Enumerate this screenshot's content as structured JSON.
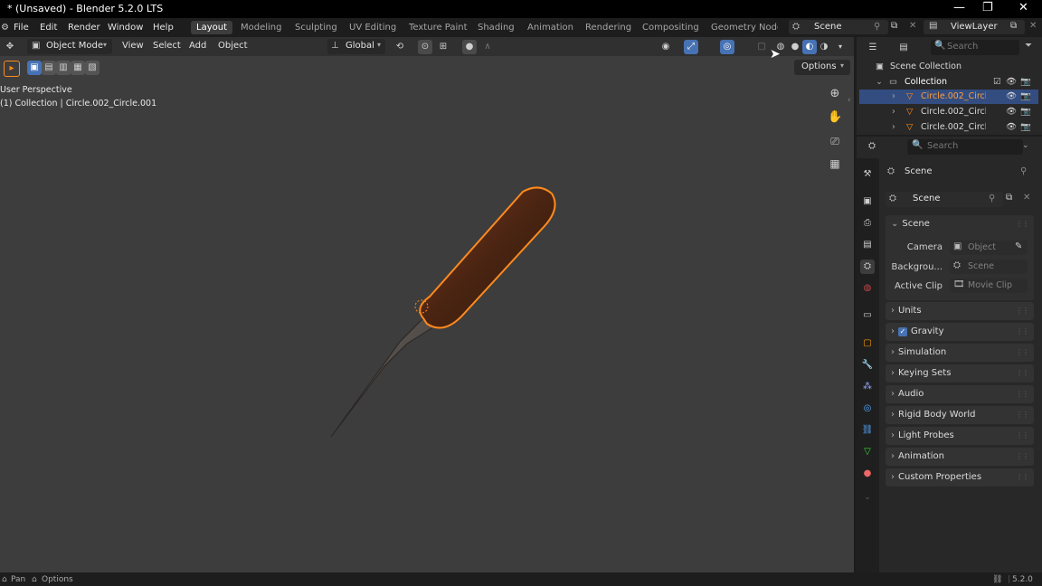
{
  "window": {
    "title": "* (Unsaved) - Blender 5.2.0 LTS",
    "controls": [
      "—",
      "❐",
      "✕"
    ]
  },
  "menu": [
    "File",
    "Edit",
    "Render",
    "Window",
    "Help"
  ],
  "workspaces": [
    "Layout",
    "Modeling",
    "Sculpting",
    "UV Editing",
    "Texture Paint",
    "Shading",
    "Animation",
    "Rendering",
    "Compositing",
    "Geometry Node"
  ],
  "scene_selector": "Scene",
  "view_layer": "ViewLayer",
  "viewport_header": {
    "mode": "Object Mode",
    "menus": [
      "View",
      "Select",
      "Add",
      "Object"
    ],
    "orientation": "Global",
    "options": "Options"
  },
  "viewport_overlay": {
    "perspective": "User Perspective",
    "context": "(1) Collection | Circle.002_Circle.001"
  },
  "outliner": {
    "search_placeholder": "Search",
    "scene_collection": "Scene Collection",
    "collection": "Collection",
    "items": [
      "Circle.002_Circl",
      "Circle.002_Circl",
      "Circle.002_Circl"
    ]
  },
  "properties": {
    "search_placeholder": "Search",
    "context_title": "Scene",
    "scene_name": "Scene",
    "scene_section": "Scene",
    "camera_label": "Camera",
    "camera_placeholder": "Object",
    "background_label": "Backgrou...",
    "background_placeholder": "Scene",
    "active_clip_label": "Active Clip",
    "active_clip_placeholder": "Movie Clip",
    "panels": [
      "Units",
      "Gravity",
      "Simulation",
      "Keying Sets",
      "Audio",
      "Rigid Body World",
      "Light Probes",
      "Animation",
      "Custom Properties"
    ]
  },
  "statusbar": {
    "left": [
      "Pan",
      "Options"
    ],
    "version": "5.2.0"
  },
  "colors": {
    "selection": "#ff8a1e",
    "active_row": "#334d80",
    "viewport_bg": "#3d3d3d"
  }
}
